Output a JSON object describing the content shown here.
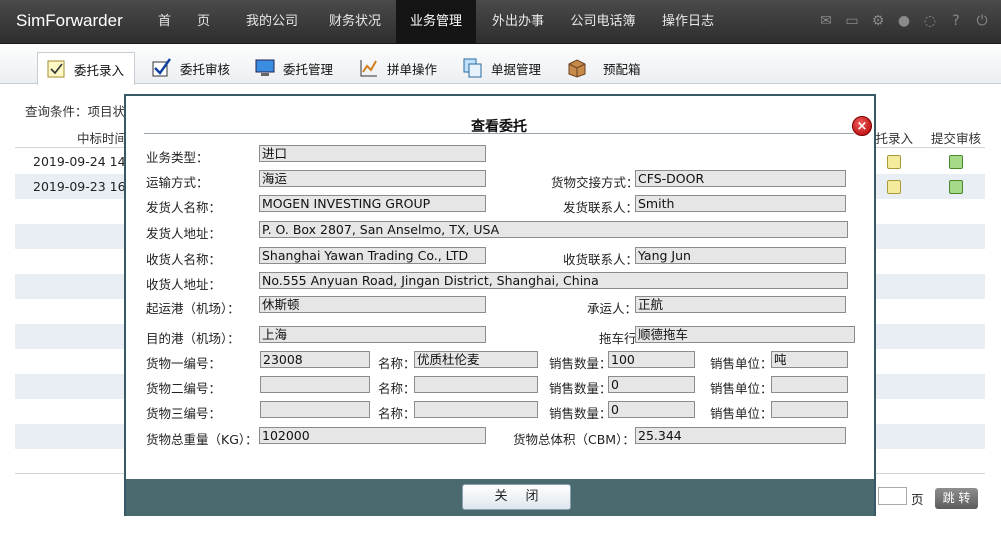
{
  "app": {
    "title": "SimForwarder"
  },
  "nav": {
    "items": [
      {
        "label": "首　　页",
        "active": false
      },
      {
        "label": "我的公司",
        "active": false
      },
      {
        "label": "财务状况",
        "active": false
      },
      {
        "label": "业务管理",
        "active": true
      },
      {
        "label": "外出办事",
        "active": false
      },
      {
        "label": "公司电话簿",
        "active": false
      },
      {
        "label": "操作日志",
        "active": false
      }
    ],
    "icons": [
      "mail-icon",
      "monitor-icon",
      "gear-icon",
      "user-icon",
      "chat-icon",
      "help-icon",
      "power-icon"
    ]
  },
  "subtabs": [
    {
      "label": "委托录入",
      "icon": "checkbox-icon",
      "active": true
    },
    {
      "label": "委托审核",
      "icon": "check-icon",
      "active": false
    },
    {
      "label": "委托管理",
      "icon": "monitor-icon",
      "active": false
    },
    {
      "label": "拼单操作",
      "icon": "chart-icon",
      "active": false
    },
    {
      "label": "单据管理",
      "icon": "documents-icon",
      "active": false
    },
    {
      "label": "预配箱",
      "icon": "box-icon",
      "active": false
    }
  ],
  "background": {
    "query_label": "查询条件：项目状态",
    "columns": {
      "time": "中标时间",
      "entry": "委托录入",
      "submit": "提交审核"
    },
    "rows": [
      {
        "date": "2019-09-24 14"
      },
      {
        "date": "2019-09-23 16"
      }
    ],
    "pager_unit": "页",
    "goto_label": "跳 转"
  },
  "modal": {
    "title": "查看委托",
    "fields": {
      "business_type": {
        "label": "业务类型：",
        "value": "进口"
      },
      "transport": {
        "label": "运输方式：",
        "value": "海运"
      },
      "handover": {
        "label": "货物交接方式：",
        "value": "CFS-DOOR"
      },
      "shipper_name": {
        "label": "发货人名称：",
        "value": "MOGEN INVESTING GROUP"
      },
      "shipper_contact": {
        "label": "发货联系人：",
        "value": "Smith"
      },
      "shipper_addr": {
        "label": "发货人地址：",
        "value": "P. O. Box 2807, San Anselmo, TX, USA"
      },
      "consignee_name": {
        "label": "收货人名称：",
        "value": "Shanghai Yawan Trading Co., LTD"
      },
      "consignee_contact": {
        "label": "收货联系人：",
        "value": "Yang Jun"
      },
      "consignee_addr": {
        "label": "收货人地址：",
        "value": "No.555 Anyuan Road, Jingan District, Shanghai, China"
      },
      "origin_port": {
        "label": "起运港（机场）：",
        "value": "休斯顿"
      },
      "carrier": {
        "label": "承运人：",
        "value": "正航"
      },
      "dest_port": {
        "label": "目的港（机场）：",
        "value": "上海"
      },
      "trucker": {
        "label": "拖车行",
        "value": "顺德拖车"
      }
    },
    "goods": [
      {
        "code_label": "货物一编号：",
        "code": "23008",
        "name_label": "名称：",
        "name": "优质杜伦麦",
        "qty_label": "销售数量：",
        "qty": "100",
        "unit_label": "销售单位：",
        "unit": "吨"
      },
      {
        "code_label": "货物二编号：",
        "code": "",
        "name_label": "名称：",
        "name": "",
        "qty_label": "销售数量：",
        "qty": "0",
        "unit_label": "销售单位：",
        "unit": ""
      },
      {
        "code_label": "货物三编号：",
        "code": "",
        "name_label": "名称：",
        "name": "",
        "qty_label": "销售数量：",
        "qty": "0",
        "unit_label": "销售单位：",
        "unit": ""
      }
    ],
    "total_weight": {
      "label": "货物总重量（KG）：",
      "value": "102000"
    },
    "total_volume": {
      "label": "货物总体积（CBM）：",
      "value": "25.344"
    },
    "close_button": "关闭"
  },
  "colors": {
    "nav_bg": "#3a3a3a",
    "modal_border": "#375a66",
    "footer_bg": "#4a6a70",
    "row_alt": "#e9eef4"
  }
}
